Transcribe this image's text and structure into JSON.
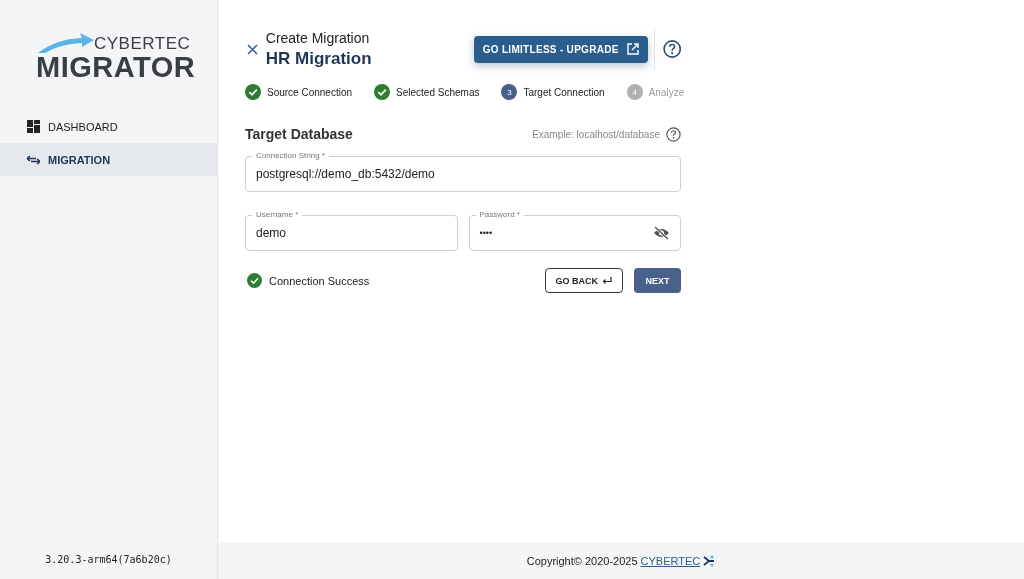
{
  "logo": {
    "brand": "CYBERTEC",
    "product": "MIGRATOR"
  },
  "sidebar": {
    "items": [
      {
        "label": "DASHBOARD",
        "kind": "dashboard",
        "selected": false
      },
      {
        "label": "MIGRATION",
        "kind": "migration",
        "selected": true
      }
    ],
    "version": "3.20.3-arm64(7a6b20c)"
  },
  "header": {
    "title": "Create Migration",
    "subtitle": "HR Migration",
    "upgrade_button": "GO LIMITLESS - UPGRADE"
  },
  "steps": [
    {
      "label": "Source Connection",
      "kind": "done"
    },
    {
      "label": "Selected Schemas",
      "kind": "done"
    },
    {
      "label": "Target Connection",
      "kind": "current",
      "number": "3"
    },
    {
      "label": "Analyze",
      "kind": "pending",
      "number": "4"
    }
  ],
  "form": {
    "title": "Target Database",
    "hint": "Example: localhost/database",
    "connection_string": {
      "label": "Connection String *",
      "value": "postgresql://demo_db:5432/demo"
    },
    "username": {
      "label": "Username *",
      "value": "demo"
    },
    "password": {
      "label": "Password *",
      "value": "••••"
    },
    "status": {
      "text": "Connection Success",
      "success": true
    },
    "back_button": "GO BACK",
    "next_button": "NEXT"
  },
  "footer": {
    "copyright": "Copyright© 2020-2025",
    "link": "CYBERTEC"
  }
}
